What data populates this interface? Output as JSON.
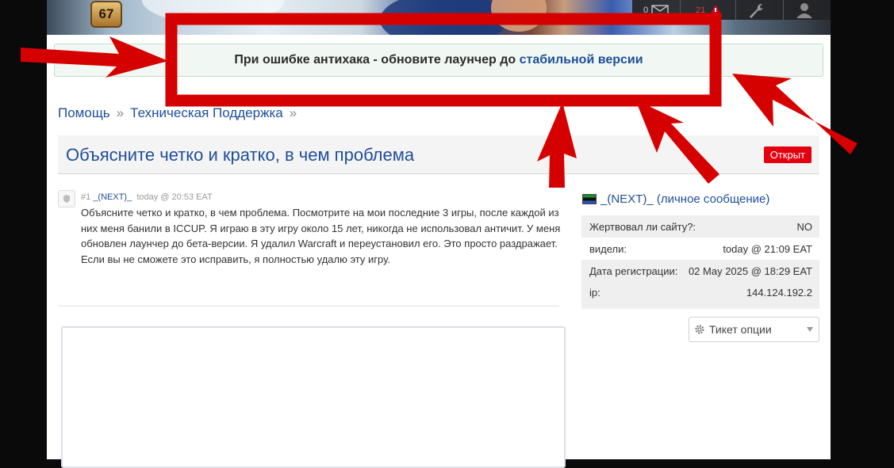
{
  "header": {
    "level": "67",
    "messages_count": "0",
    "alerts_count": "21",
    "icons": [
      "envelope-icon",
      "alert-icon",
      "wrench-icon",
      "user-icon"
    ]
  },
  "notice": {
    "text": "При ошибке антихака - обновите лаунчер до ",
    "link": "стабильной версии"
  },
  "breadcrumb": {
    "items": [
      "Помощь",
      "Техническая Поддержка"
    ],
    "separator": "»"
  },
  "ticket": {
    "title": "Объясните четко и кратко, в чем проблема",
    "status": "Открыт"
  },
  "post": {
    "number": "#1",
    "author": "_(NEXT)_",
    "time": "today @ 20:53 EAT",
    "body": "Объясните четко и кратко, в чем проблема. Посмотрите на мои последние 3 игры, после каждой из них меня банили в ICCUP. Я играю в эту игру около 15 лет, никогда не использовал античит. У меня обновлен лаунчер до бета-версии. Я удалил Warcraft и переустановил его. Это просто раздражает. Если вы не сможете это исправить, я полностью удалю эту игру."
  },
  "user_panel": {
    "name": "_(NEXT)_",
    "pm_link": "(личное сообщение)",
    "rows": [
      {
        "label": "Жертвовал ли сайту?:",
        "value": "NO"
      },
      {
        "label": "видели:",
        "value": "today @ 21:09 EAT"
      },
      {
        "label": "Дата регистрации:",
        "value": "02 May 2025 @ 18:29 EAT"
      },
      {
        "label": "ip:",
        "value": "144.124.192.2"
      }
    ],
    "options_label": "Тикет опции"
  },
  "colors": {
    "link": "#1f4e99",
    "status_open": "#e3000f",
    "annotation_arrow": "#d50000"
  }
}
